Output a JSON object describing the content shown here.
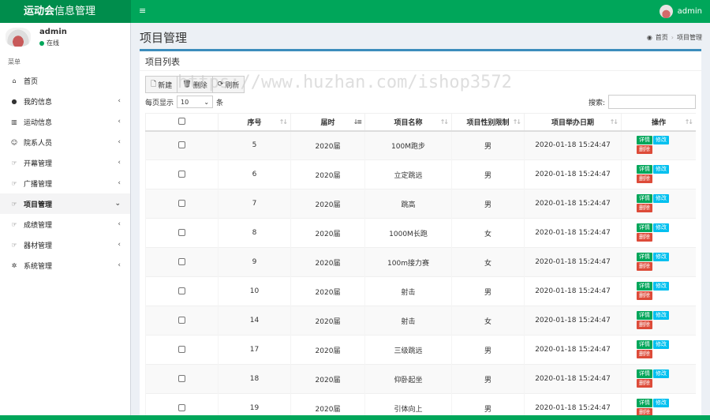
{
  "header": {
    "logo_bold": "运动会",
    "logo_rest": "信息管理",
    "menu_icon": "≡",
    "user": "admin"
  },
  "sidebar": {
    "user_name": "admin",
    "status": "在线",
    "heading": "菜单",
    "items": [
      {
        "label": "首页",
        "icon": "home-icon",
        "has_chevron": false,
        "active": false
      },
      {
        "label": "我的信息",
        "icon": "user-icon",
        "has_chevron": true,
        "active": false
      },
      {
        "label": "运动信息",
        "icon": "bar-chart-icon",
        "has_chevron": true,
        "active": false
      },
      {
        "label": "院系人员",
        "icon": "users-icon",
        "has_chevron": true,
        "active": false
      },
      {
        "label": "开幕管理",
        "icon": "hand-icon",
        "has_chevron": true,
        "active": false
      },
      {
        "label": "广播管理",
        "icon": "hand-icon",
        "has_chevron": true,
        "active": false
      },
      {
        "label": "项目管理",
        "icon": "hand-icon",
        "has_chevron": true,
        "active": true
      },
      {
        "label": "成绩管理",
        "icon": "hand-icon",
        "has_chevron": true,
        "active": false
      },
      {
        "label": "器材管理",
        "icon": "hand-icon",
        "has_chevron": true,
        "active": false
      },
      {
        "label": "系统管理",
        "icon": "gear-icon",
        "has_chevron": true,
        "active": false
      }
    ]
  },
  "page": {
    "title": "项目管理",
    "breadcrumb": [
      "首页",
      "项目管理"
    ]
  },
  "box": {
    "title": "项目列表",
    "buttons": {
      "add": "新建",
      "delete": "删除",
      "refresh": "刷新"
    },
    "length_label_pre": "每页显示",
    "length_value": "10",
    "length_label_post": "条",
    "search_label": "搜索:"
  },
  "table": {
    "headers": [
      "序号",
      "届时",
      "项目名称",
      "项目性别限制",
      "项目举办日期",
      "操作"
    ],
    "rows": [
      {
        "id": "5",
        "session": "2020届",
        "name": "100M跑步",
        "gender": "男",
        "date": "2020-01-18 15:24:47"
      },
      {
        "id": "6",
        "session": "2020届",
        "name": "立定跳远",
        "gender": "男",
        "date": "2020-01-18 15:24:47"
      },
      {
        "id": "7",
        "session": "2020届",
        "name": "跳高",
        "gender": "男",
        "date": "2020-01-18 15:24:47"
      },
      {
        "id": "8",
        "session": "2020届",
        "name": "1000M长跑",
        "gender": "女",
        "date": "2020-01-18 15:24:47"
      },
      {
        "id": "9",
        "session": "2020届",
        "name": "100m接力赛",
        "gender": "女",
        "date": "2020-01-18 15:24:47"
      },
      {
        "id": "10",
        "session": "2020届",
        "name": "射击",
        "gender": "男",
        "date": "2020-01-18 15:24:47"
      },
      {
        "id": "14",
        "session": "2020届",
        "name": "射击",
        "gender": "女",
        "date": "2020-01-18 15:24:47"
      },
      {
        "id": "17",
        "session": "2020届",
        "name": "三级跳远",
        "gender": "男",
        "date": "2020-01-18 15:24:47"
      },
      {
        "id": "18",
        "session": "2020届",
        "name": "仰卧起坐",
        "gender": "男",
        "date": "2020-01-18 15:24:47"
      },
      {
        "id": "19",
        "session": "2020届",
        "name": "引体向上",
        "gender": "男",
        "date": "2020-01-18 15:24:47"
      }
    ],
    "actions": {
      "detail": "详情",
      "edit": "修改",
      "delete": "删除"
    }
  },
  "watermark": "https://www.huzhan.com/ishop3572",
  "colors": {
    "primary": "#00a65a",
    "primary_dark": "#008d4c",
    "info": "#00c0ef",
    "danger": "#dd4b39",
    "box_border": "#3c8dbc"
  }
}
